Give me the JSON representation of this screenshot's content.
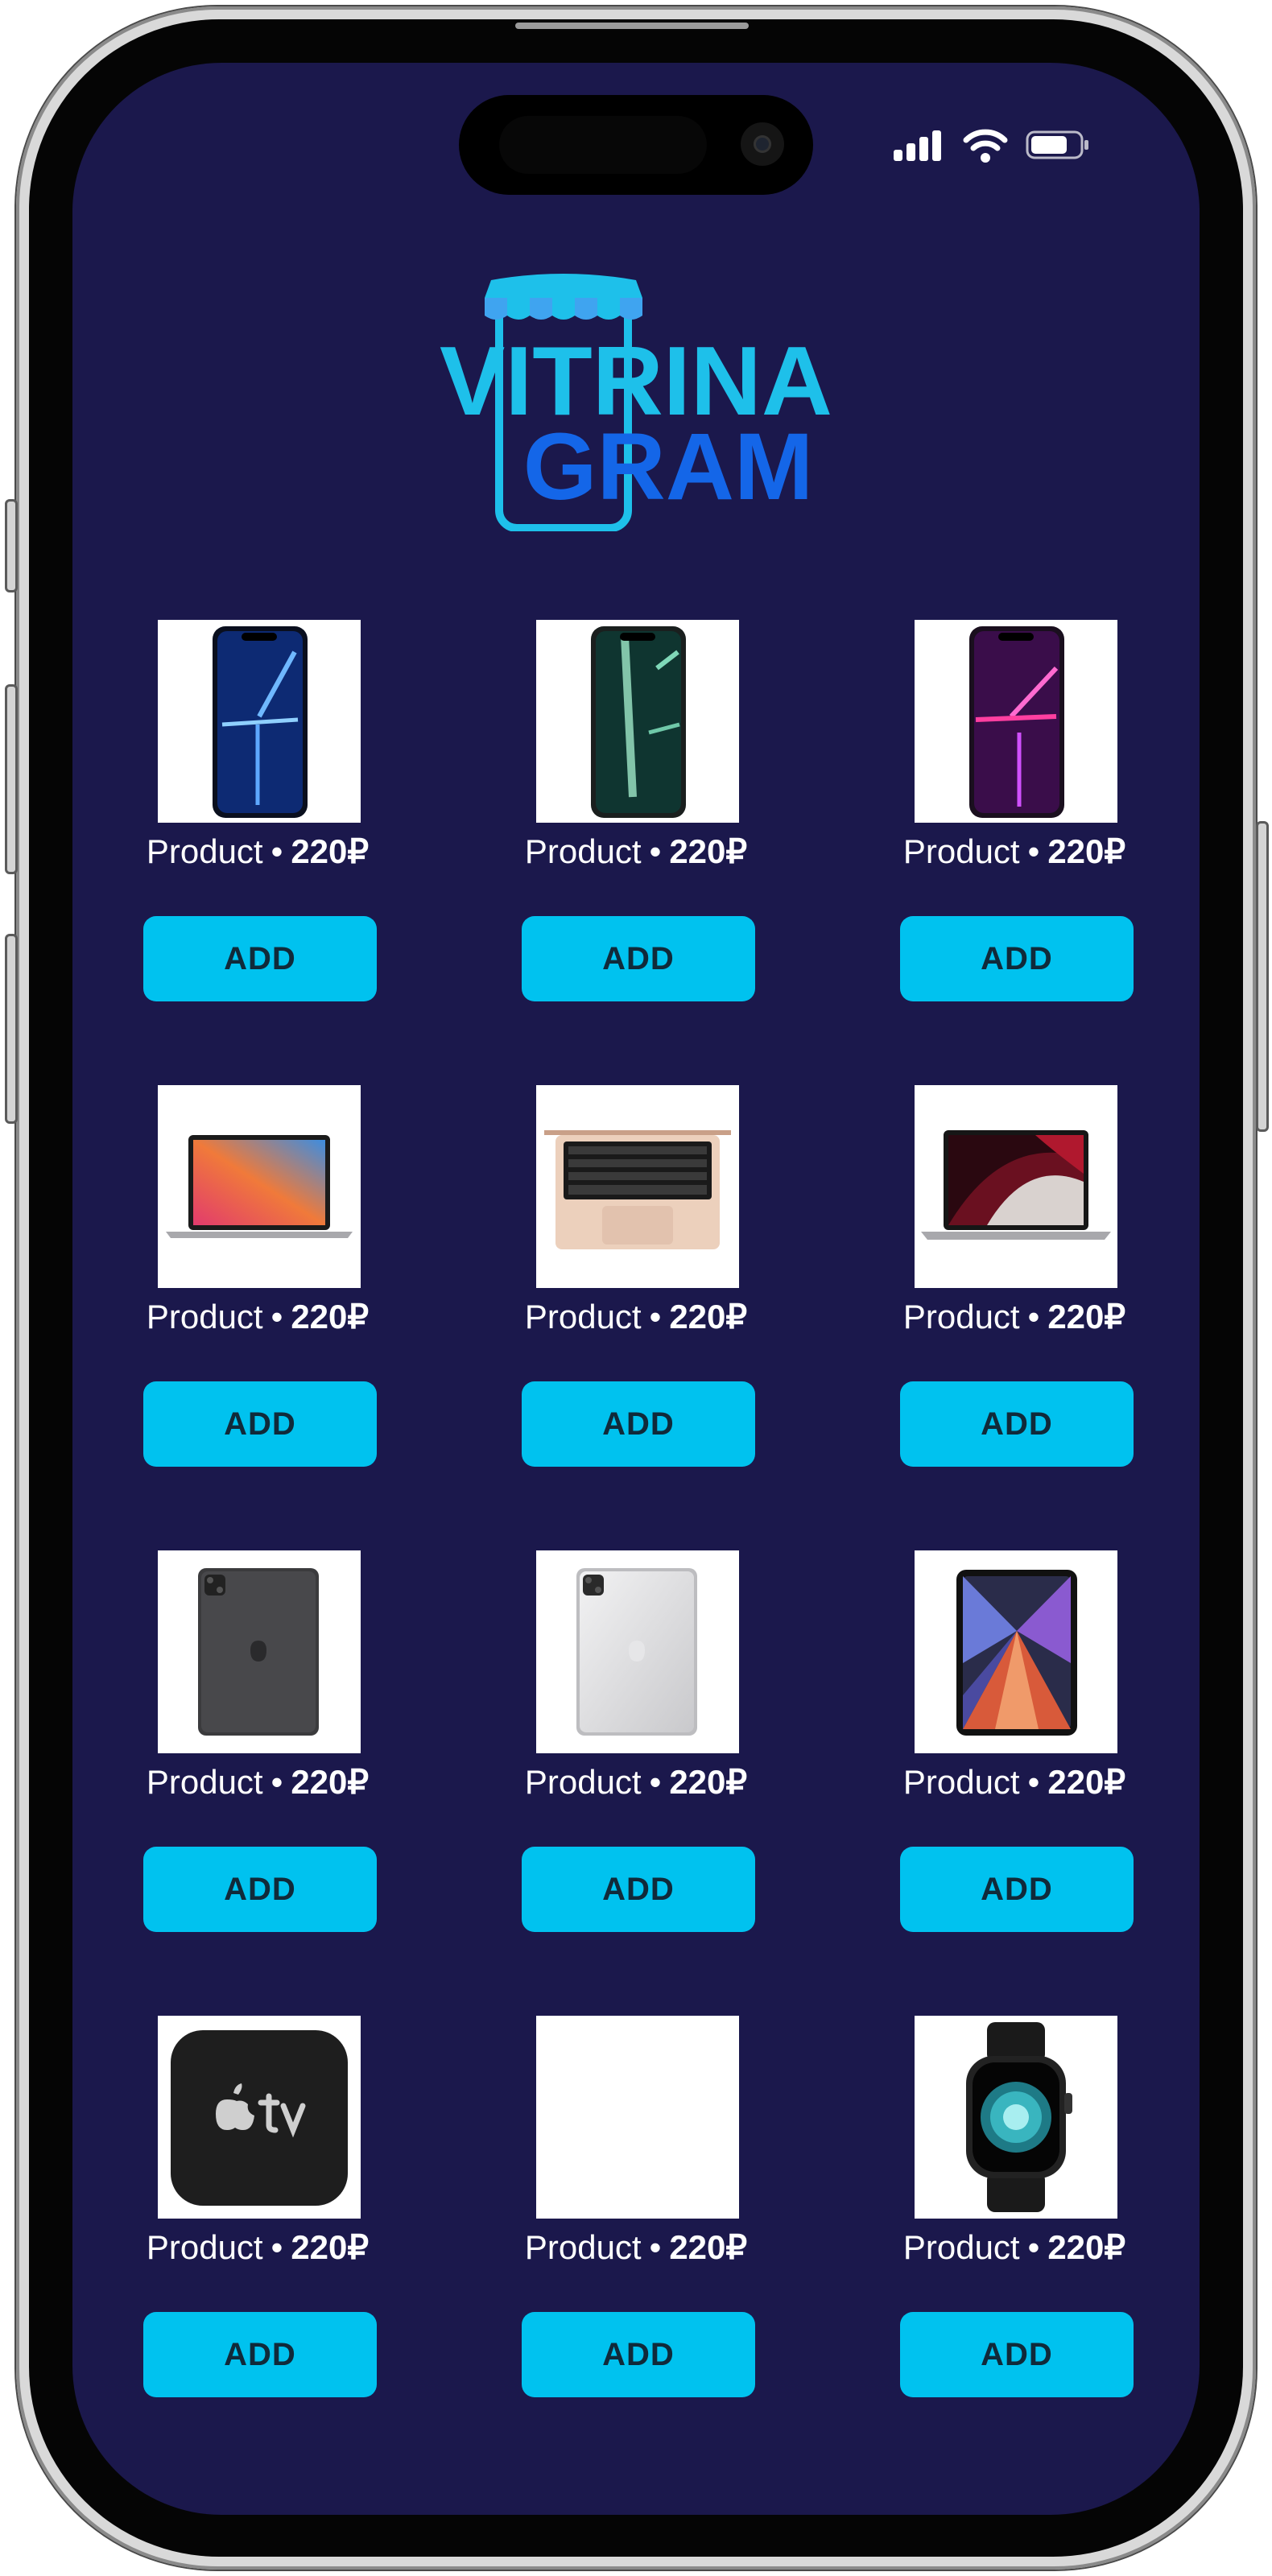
{
  "app": {
    "logo_line1": "VITRINA",
    "logo_line2": "GRAM",
    "colors": {
      "background": "#1b184c",
      "accent": "#00c2ef",
      "logo_light": "#1ec0ea",
      "logo_dark": "#1466e8"
    }
  },
  "status_bar": {
    "icons": [
      "signal-icon",
      "wifi-icon",
      "battery-icon"
    ]
  },
  "products": [
    {
      "name": "Product",
      "sep": "•",
      "price": "220₽",
      "button": "ADD",
      "image": "iphone-blue-image"
    },
    {
      "name": "Product",
      "sep": "•",
      "price": "220₽",
      "button": "ADD",
      "image": "iphone-green-image"
    },
    {
      "name": "Product",
      "sep": "•",
      "price": "220₽",
      "button": "ADD",
      "image": "iphone-purple-image"
    },
    {
      "name": "Product",
      "sep": "•",
      "price": "220₽",
      "button": "ADD",
      "image": "macbook-air-image"
    },
    {
      "name": "Product",
      "sep": "•",
      "price": "220₽",
      "button": "ADD",
      "image": "macbook-keyboard-image"
    },
    {
      "name": "Product",
      "sep": "•",
      "price": "220₽",
      "button": "ADD",
      "image": "macbook-pro-image"
    },
    {
      "name": "Product",
      "sep": "•",
      "price": "220₽",
      "button": "ADD",
      "image": "ipad-space-gray-image"
    },
    {
      "name": "Product",
      "sep": "•",
      "price": "220₽",
      "button": "ADD",
      "image": "ipad-silver-image"
    },
    {
      "name": "Product",
      "sep": "•",
      "price": "220₽",
      "button": "ADD",
      "image": "ipad-pro-display-image"
    },
    {
      "name": "Product",
      "sep": "•",
      "price": "220₽",
      "button": "ADD",
      "image": "apple-tv-image"
    },
    {
      "name": "Product",
      "sep": "•",
      "price": "220₽",
      "button": "ADD",
      "image": "blank-image"
    },
    {
      "name": "Product",
      "sep": "•",
      "price": "220₽",
      "button": "ADD",
      "image": "apple-watch-image"
    }
  ]
}
